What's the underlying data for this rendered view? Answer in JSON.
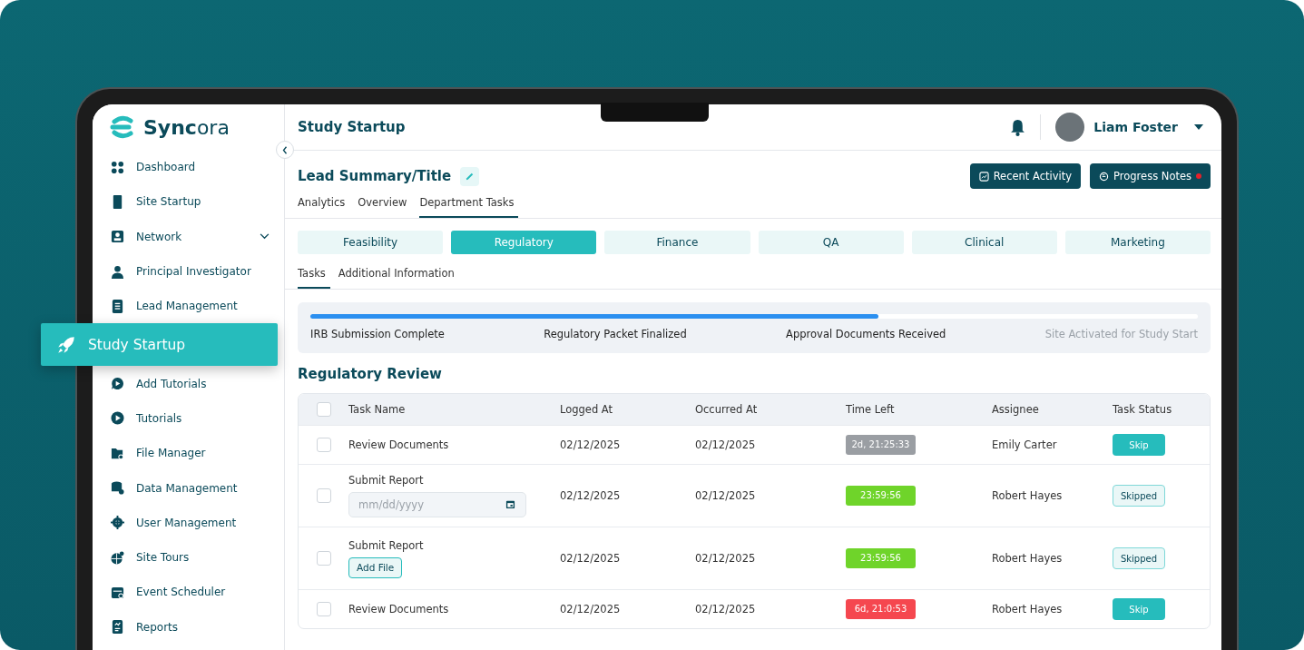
{
  "brand": {
    "name_bold": "Sync",
    "name_light": "ora"
  },
  "sidebar": {
    "items": [
      {
        "label": "Dashboard",
        "selected": false
      },
      {
        "label": "Site Startup",
        "selected": false
      },
      {
        "label": "Network",
        "selected": false,
        "expanded": false
      },
      {
        "label": "Principal Investigator",
        "selected": false
      },
      {
        "label": "Lead Management",
        "selected": false
      },
      {
        "label": "Study Startup",
        "selected": true
      },
      {
        "label": "Add Tutorials",
        "selected": false
      },
      {
        "label": "Tutorials",
        "selected": false
      },
      {
        "label": "File Manager",
        "selected": false
      },
      {
        "label": "Data Management",
        "selected": false
      },
      {
        "label": "User Management",
        "selected": false
      },
      {
        "label": "Site Tours",
        "selected": false
      },
      {
        "label": "Event Scheduler",
        "selected": false
      },
      {
        "label": "Reports",
        "selected": false
      }
    ]
  },
  "header": {
    "title": "Study Startup",
    "user": {
      "name": "Liam Foster"
    }
  },
  "lead": {
    "title": "Lead Summary/Title",
    "actions": [
      {
        "label": "Recent Activity",
        "kind": "activity",
        "unread": false
      },
      {
        "label": "Progress Notes",
        "kind": "notes",
        "unread": true
      }
    ]
  },
  "tabs": [
    {
      "label": "Analytics",
      "selected": false
    },
    {
      "label": "Overview",
      "selected": false
    },
    {
      "label": "Department Tasks",
      "selected": true
    }
  ],
  "departments": [
    {
      "label": "Feasibility",
      "selected": false
    },
    {
      "label": "Regulatory",
      "selected": true
    },
    {
      "label": "Finance",
      "selected": false
    },
    {
      "label": "QA",
      "selected": false
    },
    {
      "label": "Clinical",
      "selected": false
    },
    {
      "label": "Marketing",
      "selected": false
    }
  ],
  "subtabs": [
    {
      "label": "Tasks",
      "selected": true
    },
    {
      "label": "Additional Information",
      "selected": false
    }
  ],
  "progress": {
    "level": 0.64,
    "milestones": [
      {
        "label": "IRB Submission Complete",
        "reached": true
      },
      {
        "label": "Regulatory Packet Finalized",
        "reached": true
      },
      {
        "label": "Approval Documents Received",
        "reached": true
      },
      {
        "label": "Site Activated for Study Start",
        "reached": false
      }
    ]
  },
  "section_title": "Regulatory Review",
  "table": {
    "all_checked": false,
    "columns": [
      "Task Name",
      "Logged At",
      "Occurred At",
      "Time Left",
      "Assignee",
      "Task Status"
    ],
    "rows": [
      {
        "checked": false,
        "task": "Review Documents",
        "logged": "02/12/2025",
        "occurred": "02/12/2025",
        "time_left": "2d, 21:25:33",
        "color": "#9a9ea3",
        "assignee": "Emily Carter",
        "status": "Skip",
        "kind": "skip"
      },
      {
        "checked": false,
        "task": "Submit Report",
        "extra": {
          "kind": "date",
          "placeholder": "mm/dd/yyyy"
        },
        "logged": "02/12/2025",
        "occurred": "02/12/2025",
        "time_left": "23:59:56",
        "color": "#6fd42a",
        "assignee": "Robert Hayes",
        "status": "Skipped",
        "kind": "skipped"
      },
      {
        "checked": false,
        "task": "Submit Report",
        "extra": {
          "kind": "file",
          "label": "Add File"
        },
        "logged": "02/12/2025",
        "occurred": "02/12/2025",
        "time_left": "23:59:56",
        "color": "#6fd42a",
        "assignee": "Robert Hayes",
        "status": "Skipped",
        "kind": "skipped"
      },
      {
        "checked": false,
        "task": "Review Documents",
        "logged": "02/12/2025",
        "occurred": "02/12/2025",
        "time_left": "6d, 21:0:53",
        "color": "#f5474f",
        "assignee": "Robert Hayes",
        "status": "Skip",
        "kind": "skip"
      }
    ]
  }
}
